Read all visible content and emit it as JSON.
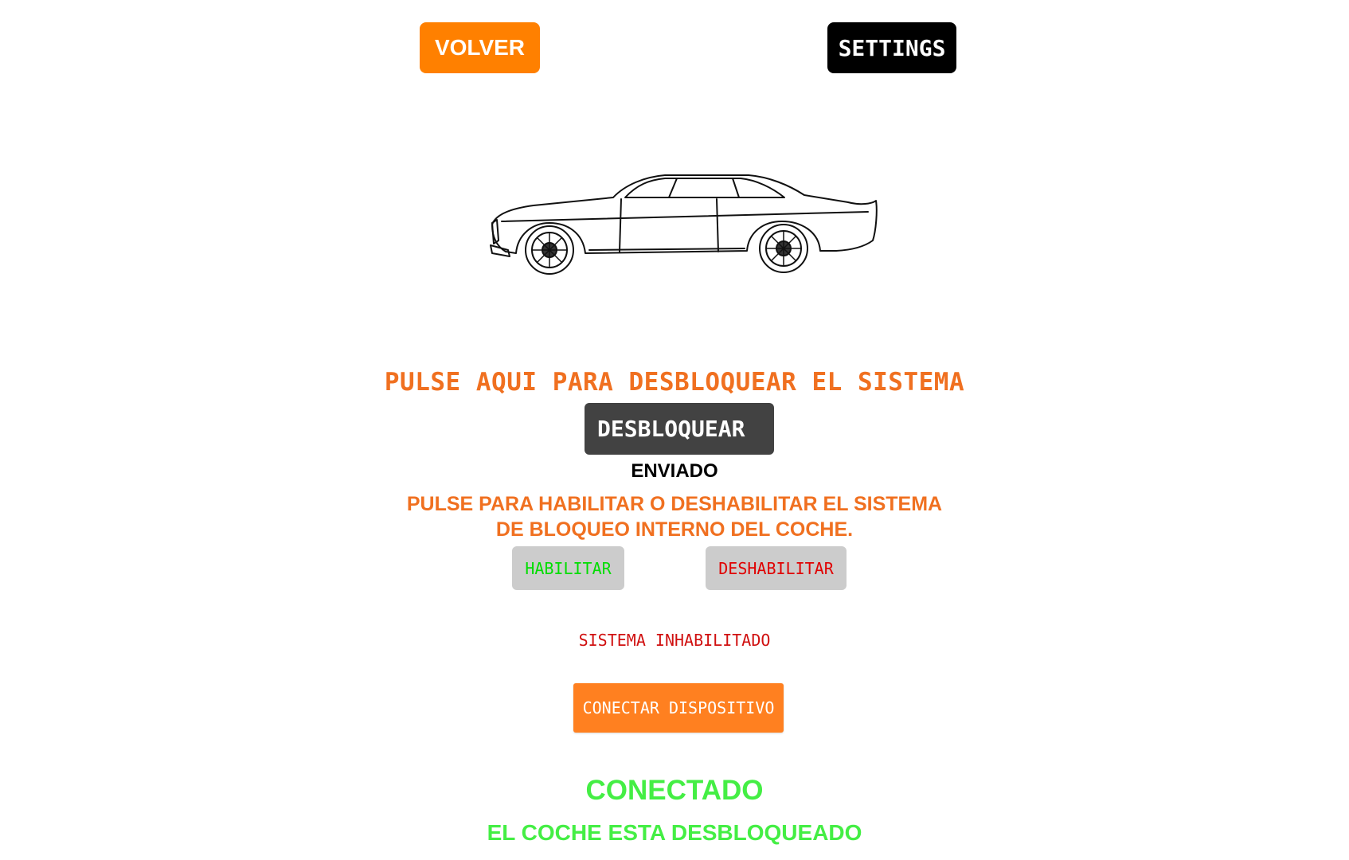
{
  "header": {
    "back_label": "VOLVER",
    "settings_label": "SETTINGS"
  },
  "unlock": {
    "prompt": "PULSE AQUI PARA DESBLOQUEAR EL SISTEMA",
    "button_label": "DESBLOQUEAR",
    "sent_status": "ENVIADO"
  },
  "lock_system": {
    "prompt": "PULSE PARA HABILITAR O DESHABILITAR EL SISTEMA DE BLOQUEO INTERNO DEL COCHE.",
    "enable_label": "HABILITAR",
    "disable_label": "DESHABILITAR",
    "status": "SISTEMA INHABILITADO"
  },
  "connection": {
    "button_label": "CONECTAR DISPOSITIVO",
    "status": "CONECTADO",
    "car_status": "EL COCHE ESTA DESBLOQUEADO"
  },
  "colors": {
    "accent_orange": "#ff8000",
    "prompt_orange": "#f07020",
    "enable_green": "#00dd00",
    "disable_red": "#e00000",
    "connected_green": "#44ee44"
  },
  "icons": {
    "car_image": "car-sketch"
  }
}
